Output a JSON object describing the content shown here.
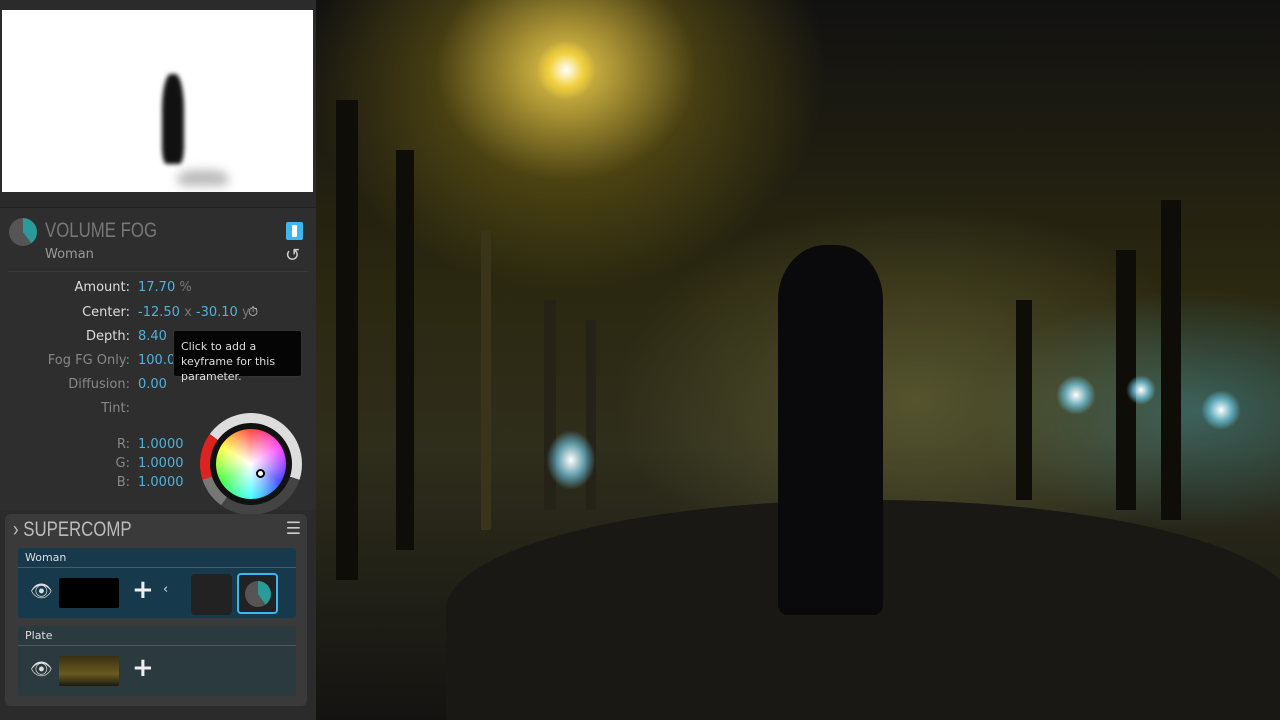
{
  "effect": {
    "title": "VOLUME FOG",
    "layer": "Woman",
    "enabled": true
  },
  "params": [
    {
      "label": "Amount:",
      "value": "17.70",
      "unit": "%"
    },
    {
      "label": "Center:",
      "x": "-12.50",
      "xunit": "x",
      "y": "-30.10",
      "yunit": "y"
    },
    {
      "label": "Depth:",
      "value": "8.40"
    },
    {
      "label": "Fog FG Only:",
      "value": "100.00"
    },
    {
      "label": "Diffusion:",
      "value": "0.00"
    },
    {
      "label": "Tint:"
    }
  ],
  "tint": {
    "r_label": "R:",
    "r": "1.0000",
    "g_label": "G:",
    "g": "1.0000",
    "b_label": "B:",
    "b": "1.0000"
  },
  "tooltip": "Click to add a keyframe for this parameter.",
  "supercomp": {
    "title": "SUPERCOMP",
    "layers": [
      {
        "name": "Woman"
      },
      {
        "name": "Plate"
      }
    ]
  },
  "icons": {
    "accent": "#3fb6ee",
    "teal": "#2a9a9a"
  }
}
